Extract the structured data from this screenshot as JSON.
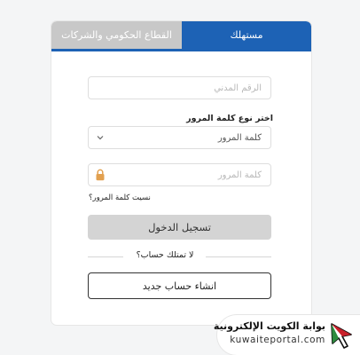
{
  "tabs": [
    {
      "label": "مستهلك",
      "active": true
    },
    {
      "label": "القطاع الحكومي والشركات",
      "active": false
    }
  ],
  "form": {
    "civil_id_placeholder": "الرقم المدني",
    "choose_password_type_label": "اختر نوع كلمة المرور",
    "password_type_selected": "كلمة المرور",
    "password_placeholder": "كلمة المرور",
    "forgot_password": "نسيت كلمة المرور؟",
    "login_button": "تسجيل الدخول",
    "no_account": "لا تمتلك حساب؟",
    "create_account_button": "انشاء حساب جديد"
  },
  "logo": {
    "arabic": "بوابة الكويت الإلكترونية",
    "english": "kuwaiteportal.com"
  },
  "colors": {
    "accent": "#1d62b5",
    "inactive_tab": "#c8c8c8",
    "lock": "#e2a04f"
  },
  "icons": [
    "chevron-down-icon",
    "lock-icon",
    "cursor-logo-icon"
  ]
}
